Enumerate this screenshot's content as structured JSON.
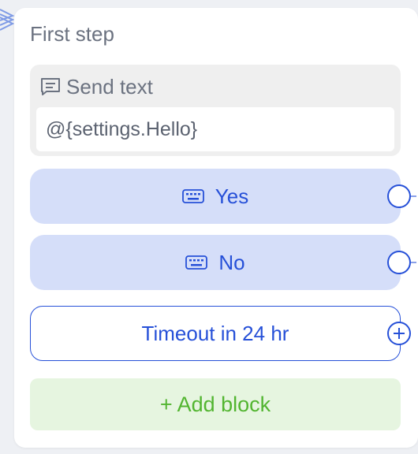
{
  "step": {
    "title": "First step"
  },
  "send_text": {
    "label": "Send text",
    "value": "@{settings.Hello}"
  },
  "choices": [
    {
      "label": "Yes",
      "icon": "keyboard-icon"
    },
    {
      "label": "No",
      "icon": "keyboard-icon"
    }
  ],
  "timeout": {
    "label": "Timeout in 24 hr"
  },
  "add_block": {
    "label": "+ Add block"
  },
  "colors": {
    "accent": "#2650d8",
    "choice_bg": "#d5def9",
    "add_block_text": "#52b530",
    "add_block_bg": "#e6f5e0"
  }
}
